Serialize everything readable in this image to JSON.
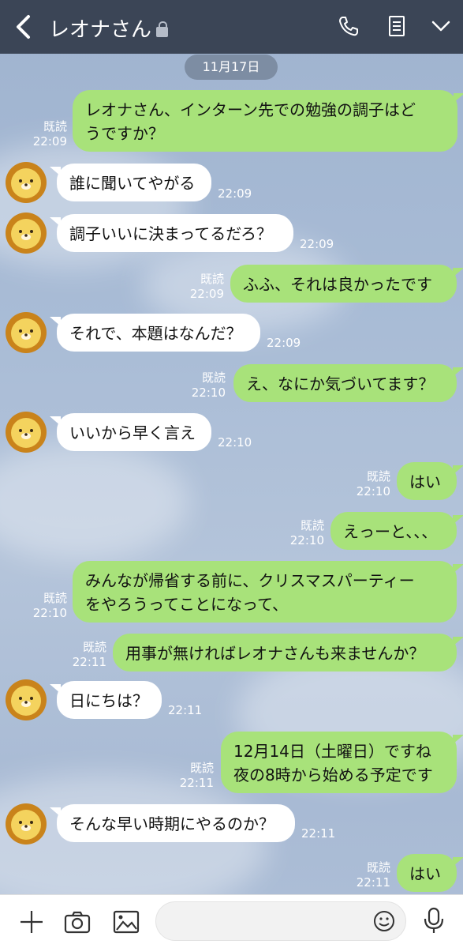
{
  "header": {
    "title": "レオナさん",
    "back_icon": "chevron-left-icon",
    "call_icon": "phone-icon",
    "notes_icon": "notes-icon",
    "menu_icon": "chevron-down-icon",
    "bg_color": "#3b4556"
  },
  "date_chip": "11月17日",
  "read_label": "既読",
  "colors": {
    "my_bubble": "#a8e27a",
    "their_bubble": "#ffffff"
  },
  "messages": [
    {
      "from": "me",
      "text": "レオナさん、インターン先での勉強の調子はどうですか？",
      "line1": "レオナさん、インターン先での勉強の調子はど",
      "line2": "うですか？",
      "time": "22:09",
      "read": true
    },
    {
      "from": "them",
      "text": "誰に聞いてやがる",
      "time": "22:09"
    },
    {
      "from": "them",
      "text": "調子いいに決まってるだろ？",
      "time": "22:09"
    },
    {
      "from": "me",
      "text": "ふふ、それは良かったです",
      "time": "22:09",
      "read": true
    },
    {
      "from": "them",
      "text": "それで、本題はなんだ？",
      "time": "22:09"
    },
    {
      "from": "me",
      "text": "え、なにか気づいてます？",
      "time": "22:10",
      "read": true
    },
    {
      "from": "them",
      "text": "いいから早く言え",
      "time": "22:10"
    },
    {
      "from": "me",
      "text": "はい",
      "time": "22:10",
      "read": true
    },
    {
      "from": "me",
      "text": "えっーと、、、",
      "time": "22:10",
      "read": true
    },
    {
      "from": "me",
      "text": "みんなが帰省する前に、クリスマスパーティーをやろうってことになって、",
      "line1": "みんなが帰省する前に、クリスマスパーティー",
      "line2": "をやろうってことになって、",
      "time": "22:10",
      "read": true
    },
    {
      "from": "me",
      "text": "用事が無ければレオナさんも来ませんか？",
      "time": "22:11",
      "read": true
    },
    {
      "from": "them",
      "text": "日にちは？",
      "time": "22:11"
    },
    {
      "from": "me",
      "text": "12月14日（土曜日）ですね 夜の8時から始める予定です",
      "line1": "12月14日（土曜日）ですね",
      "line2": "夜の8時から始める予定です",
      "time": "22:11",
      "read": true
    },
    {
      "from": "them",
      "text": "そんな早い時期にやるのか？",
      "time": "22:11"
    },
    {
      "from": "me",
      "text": "はい",
      "time": "22:11",
      "read": true
    }
  ],
  "input_bar": {
    "plus_icon": "plus-icon",
    "camera_icon": "camera-icon",
    "image_icon": "image-icon",
    "placeholder": "",
    "emoji_icon": "emoji-icon",
    "mic_icon": "microphone-icon"
  }
}
